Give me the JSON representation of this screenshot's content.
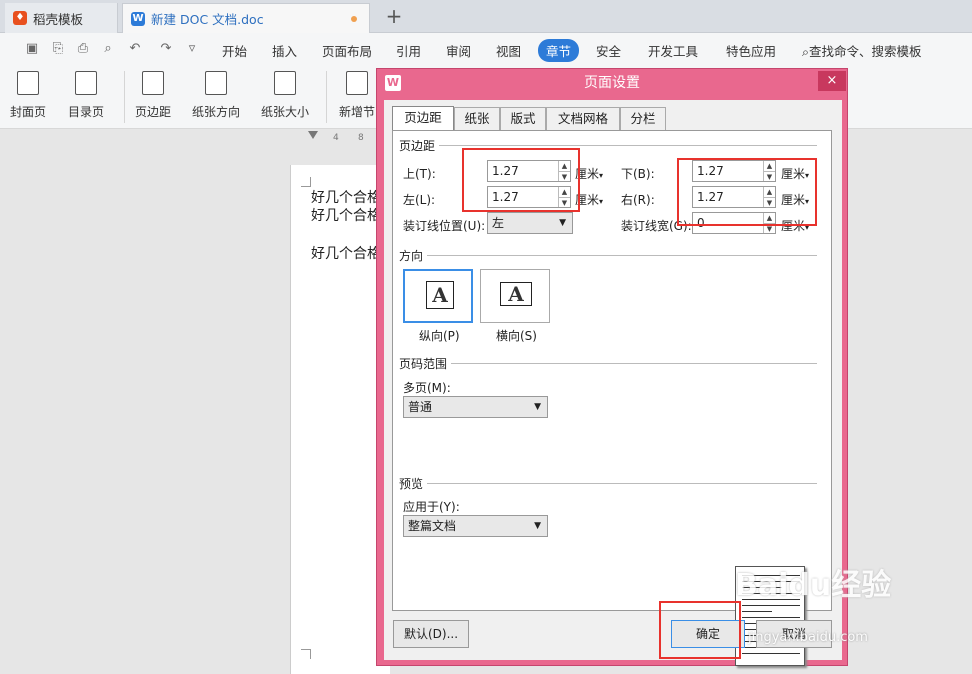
{
  "tabs": [
    {
      "label": "稻壳模板",
      "icon": "daoke-logo-icon"
    },
    {
      "label": "新建 DOC 文档.doc",
      "icon": "wps-writer-icon"
    }
  ],
  "new_tab": "+",
  "menu": [
    "开始",
    "插入",
    "页面布局",
    "引用",
    "审阅",
    "视图",
    "章节",
    "安全",
    "开发工具",
    "特色应用"
  ],
  "search_cmd": "查找命令、搜索模板",
  "ribbon": [
    "封面页",
    "目录页",
    "页边距",
    "纸张方向",
    "纸张大小",
    "新增节"
  ],
  "ruler": {
    "left": "4",
    "right": "8"
  },
  "doc_lines": [
    "好几个合格",
    "好几个合格",
    "好几个合格"
  ],
  "dialog": {
    "title": "页面设置",
    "close": "×",
    "tabs": [
      "页边距",
      "纸张",
      "版式",
      "文档网格",
      "分栏"
    ],
    "margins_section": "页边距",
    "top_label": "上(T):",
    "top_value": "1.27",
    "left_label": "左(L):",
    "left_value": "1.27",
    "bottom_label": "下(B):",
    "bottom_value": "1.27",
    "right_label": "右(R):",
    "right_value": "1.27",
    "unit": "厘米",
    "gutter_pos_label": "装订线位置(U):",
    "gutter_pos_value": "左",
    "gutter_width_label": "装订线宽(G):",
    "gutter_width_value": "0",
    "orientation_section": "方向",
    "portrait_label": "纵向(P)",
    "landscape_label": "横向(S)",
    "orientation_glyph": "A",
    "pages_section": "页码范围",
    "multi_page_label": "多页(M):",
    "multi_page_value": "普通",
    "preview_section": "预览",
    "apply_label": "应用于(Y):",
    "apply_value": "整篇文档",
    "default_btn": "默认(D)...",
    "ok_btn": "确定",
    "cancel_btn": "取消"
  },
  "watermark": {
    "brand": "Baidu经验",
    "url": "jingyan.baidu.com"
  },
  "colors": {
    "dialog_frame": "#e9688e",
    "accent": "#2d7bd8",
    "highlight": "#e8322d"
  }
}
